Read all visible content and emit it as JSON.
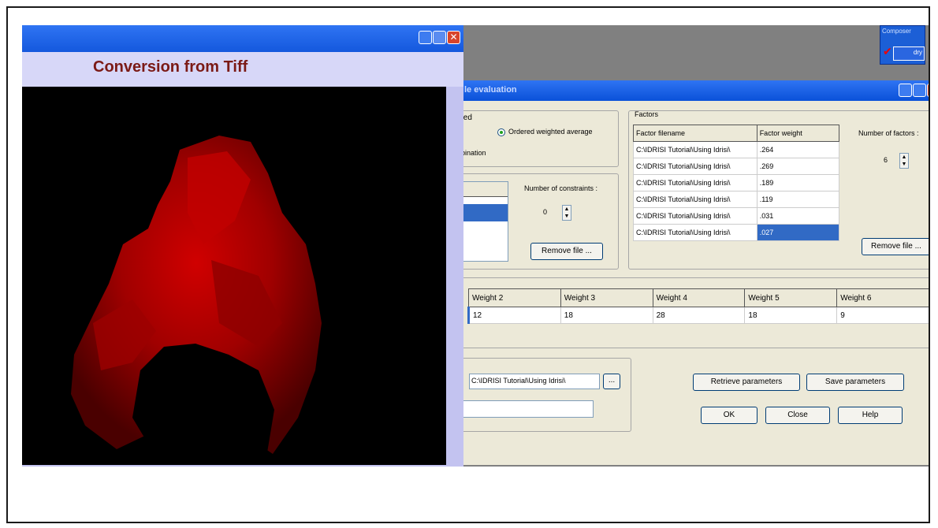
{
  "image_window": {
    "heading": "Conversion from Tiff",
    "controls": {
      "minimize": "_",
      "maximize": "□",
      "close": "✕"
    }
  },
  "composer": {
    "title": "Composer",
    "layer": "dry"
  },
  "dialog": {
    "title": "le evaluation",
    "aggregation": {
      "group_label": "ted",
      "owa_label": "Ordered weighted average",
      "combination_label": "bination"
    },
    "constraints": {
      "count_label": "Number of constraints :",
      "count": "0",
      "remove_button": "Remove file ..."
    },
    "factors": {
      "group_label": "Factors",
      "col_filename": "Factor filename",
      "col_weight": "Factor weight",
      "rows": [
        {
          "file": "C:\\IDRISI Tutorial\\Using Idrisi\\",
          "weight": ".264"
        },
        {
          "file": "C:\\IDRISI Tutorial\\Using Idrisi\\",
          "weight": ".269"
        },
        {
          "file": "C:\\IDRISI Tutorial\\Using Idrisi\\",
          "weight": ".189"
        },
        {
          "file": "C:\\IDRISI Tutorial\\Using Idrisi\\",
          "weight": ".119"
        },
        {
          "file": "C:\\IDRISI Tutorial\\Using Idrisi\\",
          "weight": ".031"
        },
        {
          "file": "C:\\IDRISI Tutorial\\Using Idrisi\\",
          "weight": ".027"
        }
      ],
      "count_label": "Number of factors :",
      "count": "6",
      "remove_button": "Remove file ..."
    },
    "order_weights": {
      "headers": [
        "Weight 2",
        "Weight 3",
        "Weight 4",
        "Weight 5",
        "Weight 6"
      ],
      "values": [
        "12",
        "18",
        "28",
        "18",
        "9"
      ]
    },
    "output": {
      "path": "C:\\IDRISI Tutorial\\Using Idrisi\\",
      "browse": "...",
      "title_value": ""
    },
    "buttons": {
      "retrieve": "Retrieve parameters",
      "save": "Save parameters",
      "ok": "OK",
      "close": "Close",
      "help": "Help"
    }
  },
  "colors": {
    "titlebar": "#0a51d9",
    "dialog_bg": "#ece9d8",
    "heading": "#7b1a16",
    "image_red": "#c40000"
  }
}
